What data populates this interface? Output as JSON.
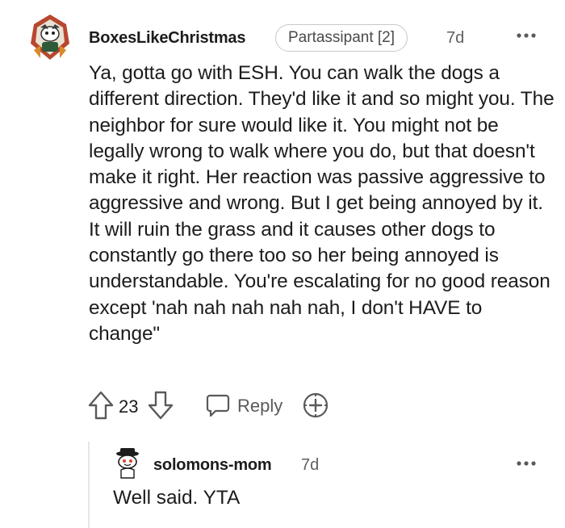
{
  "comment": {
    "author": "BoxesLikeChristmas",
    "flair": "Partassipant [2]",
    "time": "7d",
    "more_icon": "more-horizontal-icon",
    "body": "Ya, gotta go with ESH. You can walk the dogs a different direction. They'd like it and so might you. The neighbor for sure would like it. You might not be legally wrong to walk where you do, but that doesn't make it right. Her reaction was passive aggressive to aggressive and wrong. But I get being annoyed by it. It will ruin the grass and it causes other dogs to constantly go there too so her being annoyed is understandable. You're escalating for no good reason except 'nah nah nah nah nah, I don't HAVE to change\"",
    "actions": {
      "upvote_icon": "upvote-arrow-icon",
      "score": "23",
      "downvote_icon": "downvote-arrow-icon",
      "reply_icon": "speech-bubble-icon",
      "reply_label": "Reply",
      "award_icon": "award-plus-icon"
    }
  },
  "reply": {
    "author": "solomons-mom",
    "time": "7d",
    "more_icon": "more-horizontal-icon",
    "body": "Well said. YTA"
  },
  "colors": {
    "text": "#1c1c1c",
    "meta": "#5f5f5f",
    "flair_border": "#c8c8c8",
    "icon": "#5a5a5a",
    "thread_line": "#e6e6e6"
  }
}
